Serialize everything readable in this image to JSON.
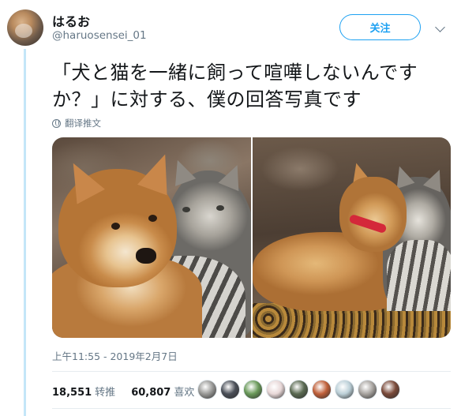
{
  "user": {
    "display_name": "はるお",
    "handle": "@haruosensei_01"
  },
  "actions": {
    "follow_label": "关注"
  },
  "tweet": {
    "text": "「犬と猫を一緒に飼って喧嘩しないんですか？」に対する、僕の回答写真です",
    "translate_label": "翻译推文",
    "timestamp": "上午11:55 - 2019年2月7日"
  },
  "stats": {
    "retweets": "18,551",
    "retweets_label": "转推",
    "likes": "60,807",
    "likes_label": "喜欢"
  },
  "likers": [
    {
      "color": "#9a9a98"
    },
    {
      "color": "#4a4f58"
    },
    {
      "color": "#6a9a5a"
    },
    {
      "color": "#e8d8d8"
    },
    {
      "color": "#5a6a52"
    },
    {
      "color": "#c0603a"
    },
    {
      "color": "#bcd0d8"
    },
    {
      "color": "#a8a4a0"
    },
    {
      "color": "#7a4a3a"
    }
  ],
  "colors": {
    "accent": "#1da1f2",
    "secondary_text": "#657786",
    "thread_line": "#c4e6f8"
  }
}
